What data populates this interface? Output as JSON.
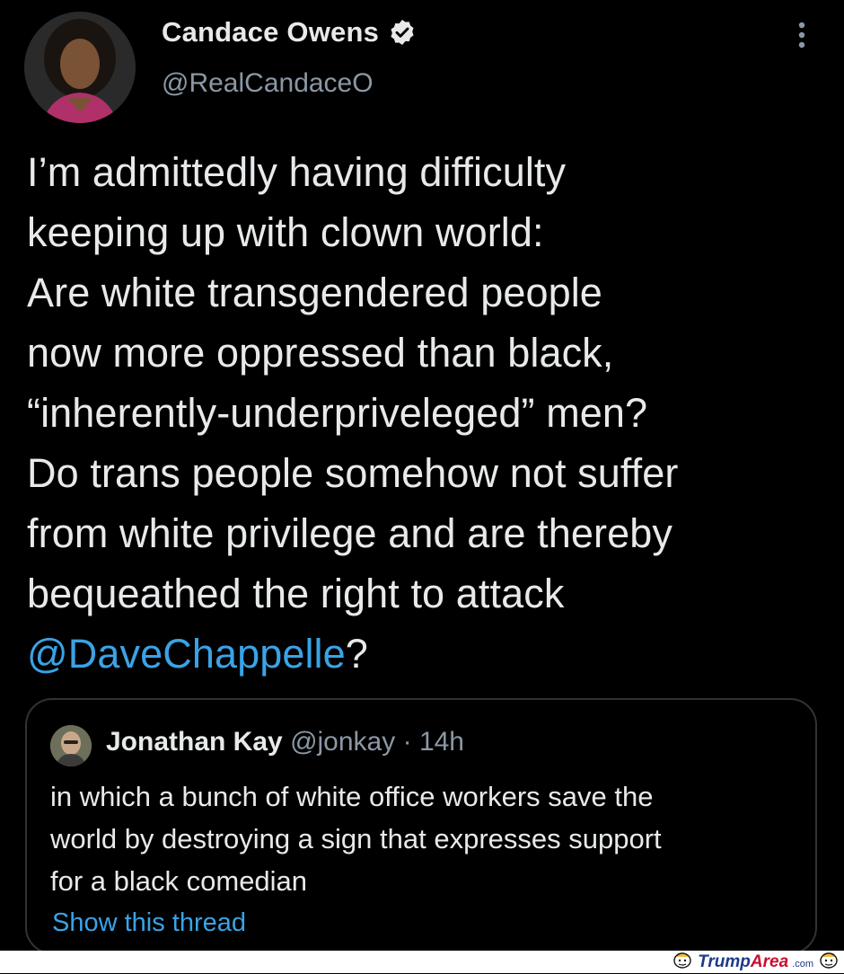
{
  "author": {
    "display_name": "Candace Owens",
    "handle": "@RealCandaceO",
    "verified": true
  },
  "menu_icon": "more-vertical-icon",
  "tweet": {
    "lines": [
      "I’m admittedly having difficulty",
      "keeping up with clown world:",
      "Are white transgendered people",
      "now more oppressed than black,",
      "“inherently-underpriveleged” men?",
      "Do trans people somehow not suffer",
      "from white privilege and are thereby",
      "bequeathed the right to attack"
    ],
    "mention": "@DaveChappelle",
    "mention_suffix": "?"
  },
  "quoted_tweet": {
    "display_name": "Jonathan Kay",
    "handle": "@jonkay",
    "separator": "·",
    "time": "14h",
    "lines": [
      "in which a bunch of white office workers save the",
      "world by destroying a sign that expresses support",
      "for a black comedian"
    ],
    "show_thread": "Show this thread"
  },
  "watermark": {
    "brand_part1": "Trump",
    "brand_part2": "Area",
    "suffix": ".com"
  },
  "colors": {
    "background": "#000000",
    "text": "#e7e9ea",
    "secondary": "#8b98a5",
    "link": "#3aa3e6",
    "border": "#2f3336"
  }
}
